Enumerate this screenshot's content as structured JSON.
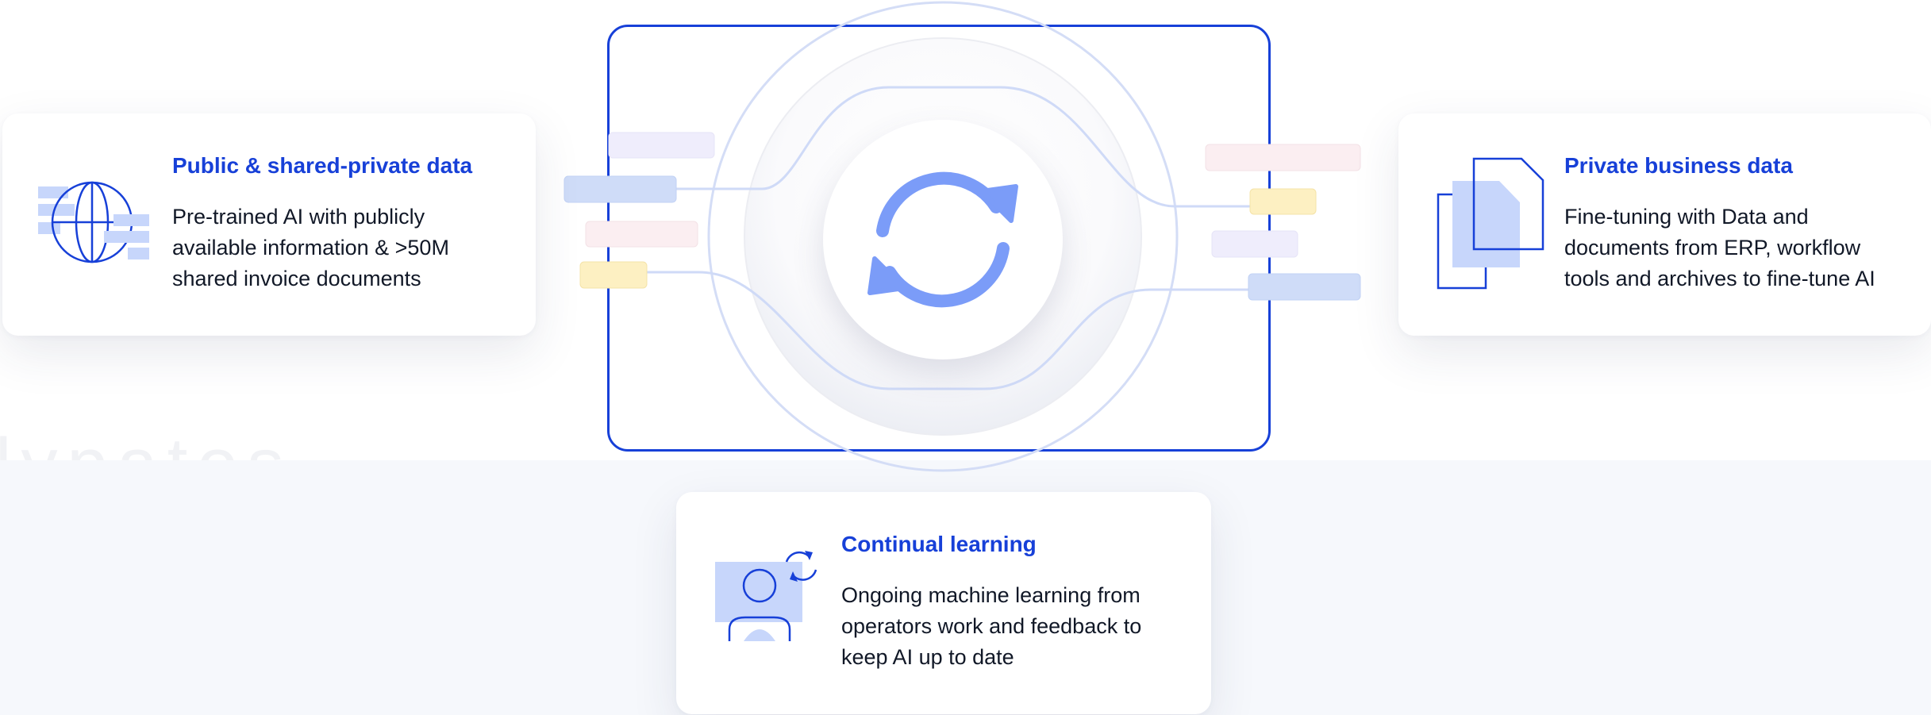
{
  "colors": {
    "accent": "#1740d8",
    "icon_fill": "#c7d6fb",
    "sync_icon": "#7b9cf8",
    "pill_blue": "#cfdcf8",
    "pill_lavender": "#efedfc",
    "pill_pink": "#fbeef1",
    "pill_yellow": "#fdf0c2"
  },
  "watermark_text": "lypatos",
  "center_icon": "sync-icon",
  "cards": {
    "public": {
      "icon": "globe-icon",
      "title": "Public & shared-private data",
      "lines": [
        "Pre-trained AI with publicly",
        "available information & >50M",
        "shared invoice documents"
      ]
    },
    "private": {
      "icon": "documents-icon",
      "title": "Private business data",
      "lines": [
        "Fine-tuning with Data and",
        "documents from ERP, workflow",
        "tools and archives to fine-tune AI"
      ]
    },
    "learning": {
      "icon": "user-sync-icon",
      "title": "Continual learning",
      "lines": [
        "Ongoing machine learning from",
        "operators work and feedback to",
        "keep AI up to date"
      ]
    }
  }
}
